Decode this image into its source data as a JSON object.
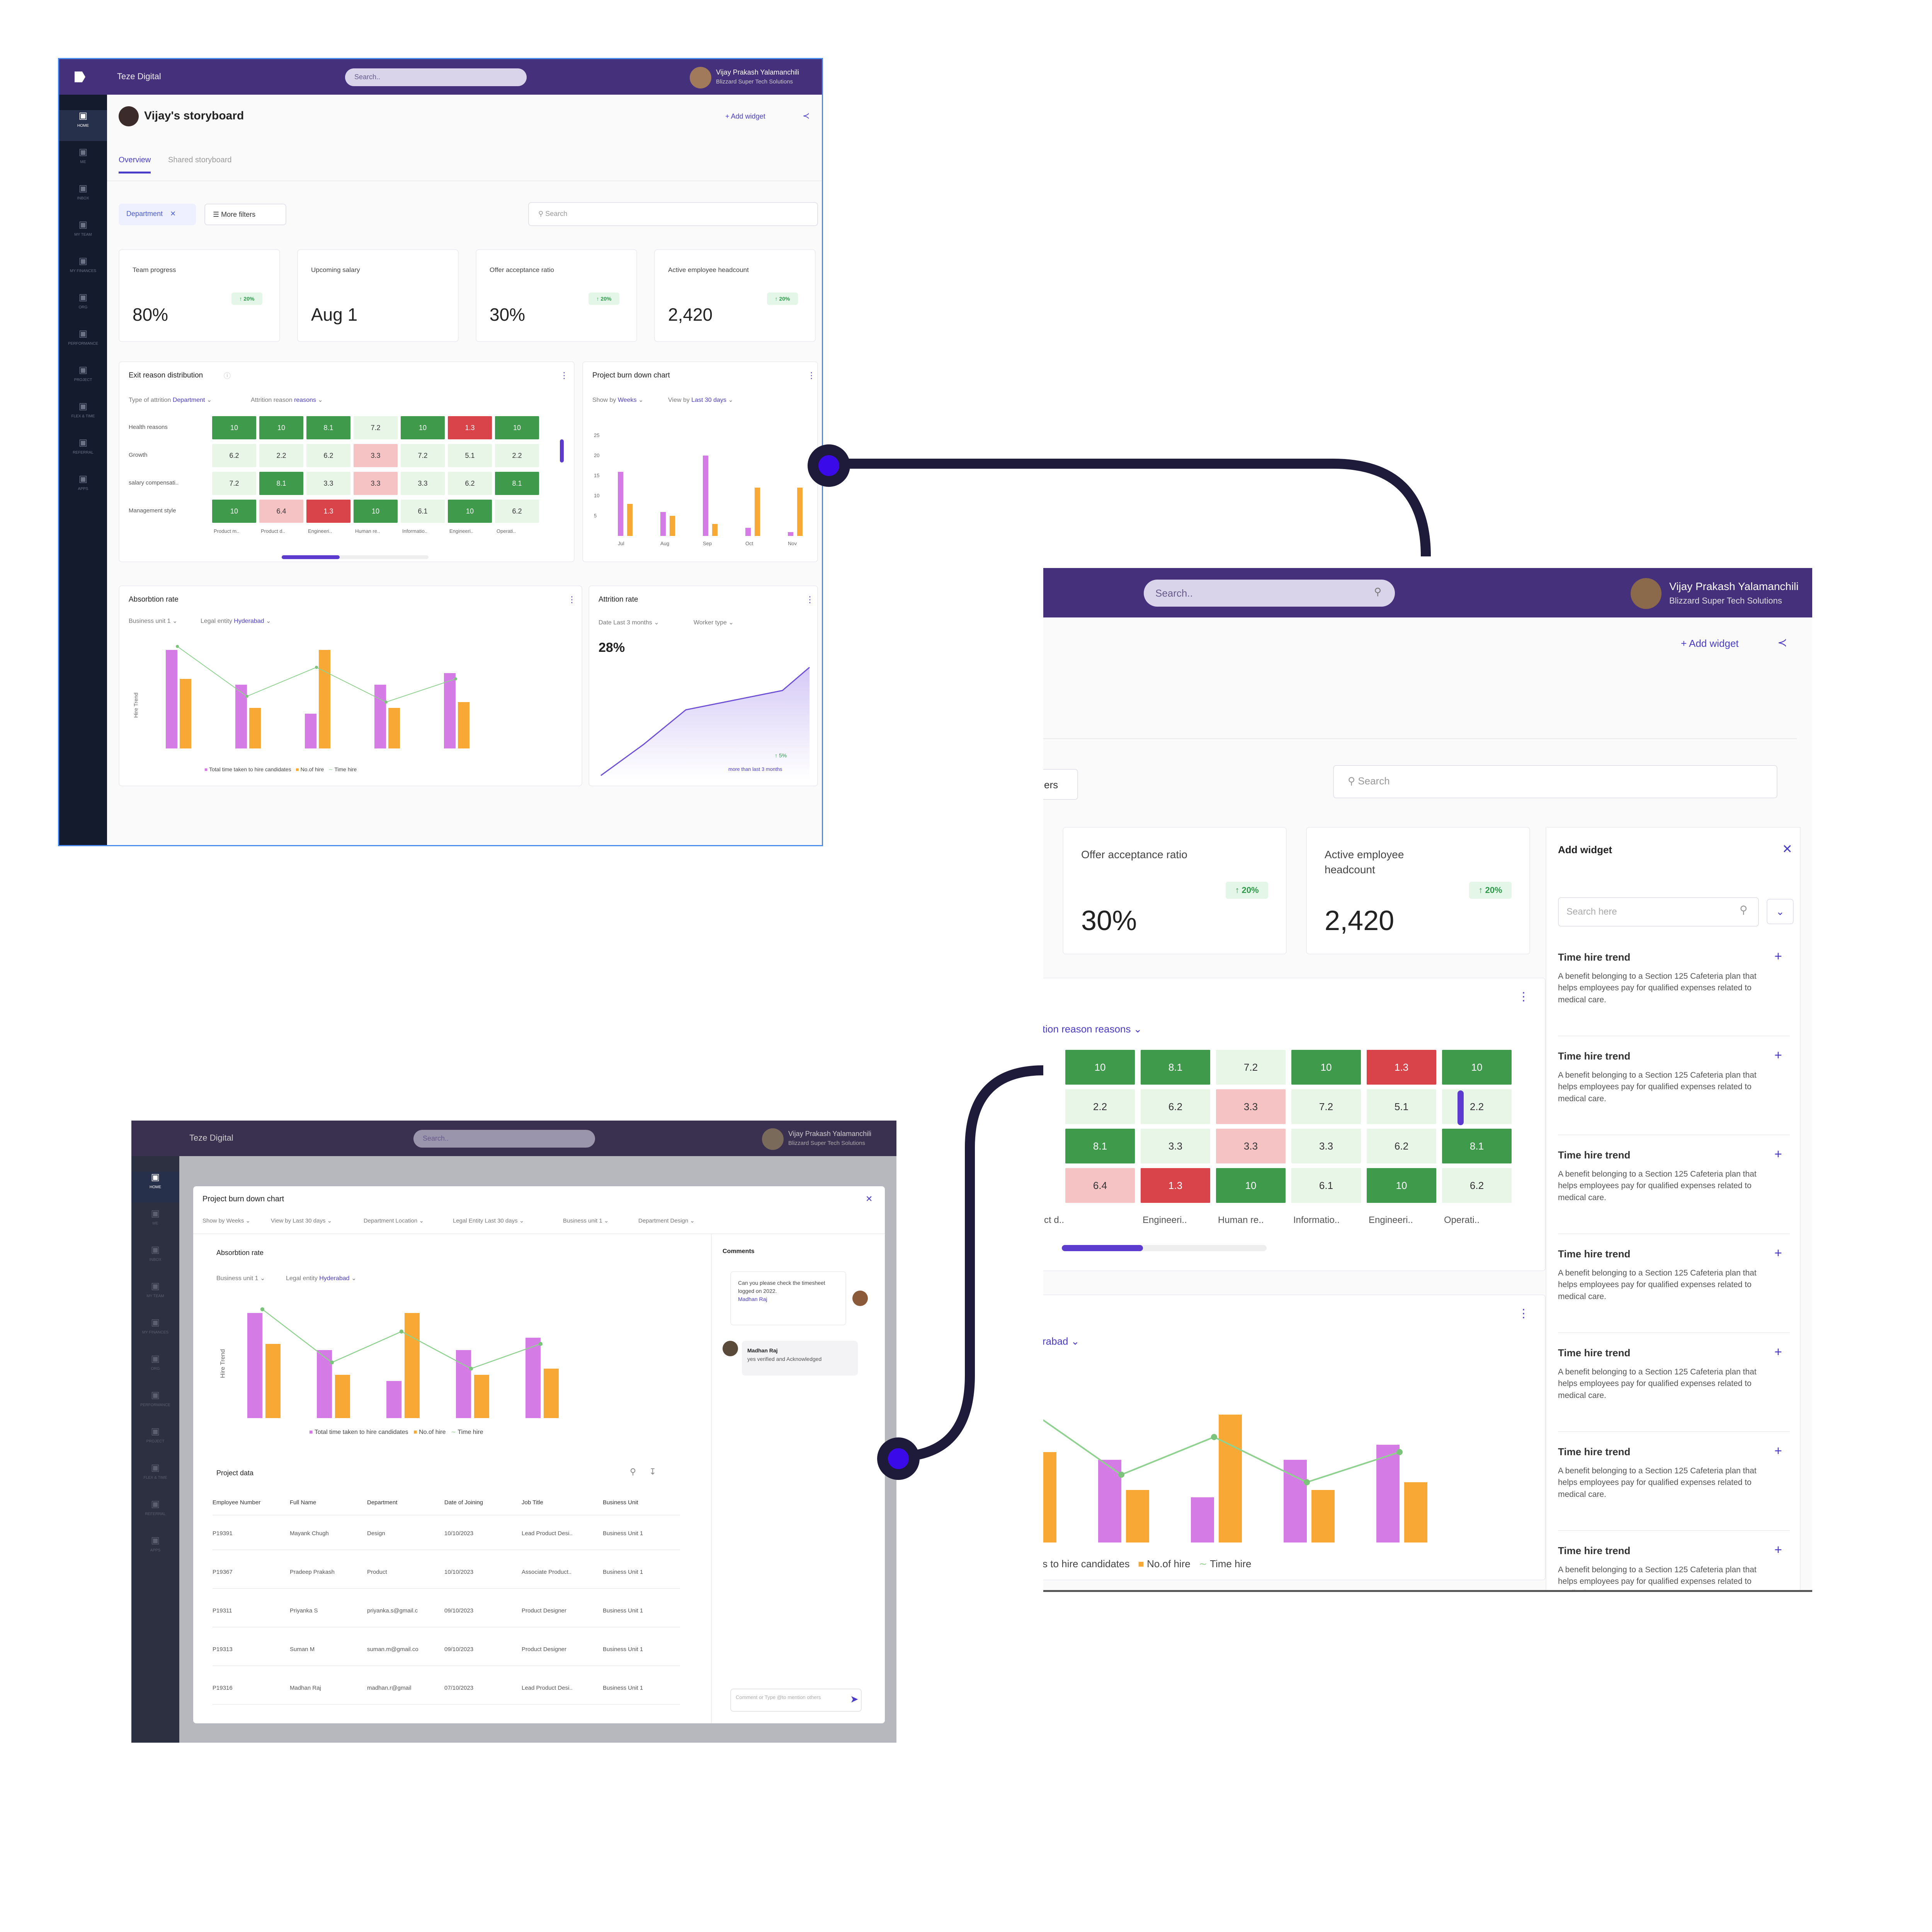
{
  "topbar": {
    "org": "Teze Digital",
    "search_placeholder": "Search..",
    "user_name": "Vijay Prakash Yalamanchili",
    "user_company": "Blizzard Super Tech Solutions"
  },
  "sidebar": [
    "HOME",
    "ME",
    "INBOX",
    "MY TEAM",
    "MY FINANCES",
    "ORG",
    "PERFORMANCE",
    "PROJECT",
    "FLEX & TIME",
    "REFERRAL",
    "APPS"
  ],
  "page": {
    "title": "Vijay's storyboard",
    "add_widget": "Add widget",
    "tabs": [
      "Overview",
      "Shared storyboard"
    ],
    "filter_chip": "Department",
    "more_filters": "More filters",
    "search_placeholder": "Search"
  },
  "kpis": [
    {
      "label": "Team progress",
      "value": "80%",
      "delta": "20%"
    },
    {
      "label": "Upcoming salary",
      "value": "Aug 1",
      "delta": ""
    },
    {
      "label": "Offer acceptance ratio",
      "value": "30%",
      "delta": "20%"
    },
    {
      "label": "Active employee headcount",
      "value": "2,420",
      "delta": "20%"
    }
  ],
  "exit_widget": {
    "title": "Exit reason distribution",
    "filter1": "Type of attrition",
    "filter1_value": "Department",
    "filter2": "Attrition reason",
    "filter2_value": "reasons",
    "rows": [
      "Health reasons",
      "Growth",
      "salary compensati..",
      "Management style"
    ],
    "cols": [
      "Product m..",
      "Product d..",
      "Engineeri..",
      "Human re..",
      "Informatio..",
      "Engineeri..",
      "Operati.."
    ],
    "cells": [
      [
        "10",
        "10",
        "8.1",
        "7.2",
        "10",
        "1.3",
        "10"
      ],
      [
        "6.2",
        "2.2",
        "6.2",
        "3.3",
        "7.2",
        "5.1",
        "2.2"
      ],
      [
        "7.2",
        "8.1",
        "3.3",
        "3.3",
        "3.3",
        "6.2",
        "8.1"
      ],
      [
        "10",
        "6.4",
        "1.3",
        "10",
        "6.1",
        "10",
        "6.2"
      ]
    ],
    "cell_colors": [
      [
        "g",
        "g",
        "g",
        "l",
        "g",
        "r",
        "g"
      ],
      [
        "l",
        "l",
        "l",
        "p",
        "l",
        "l",
        "l"
      ],
      [
        "l",
        "g",
        "l",
        "p",
        "l",
        "l",
        "g"
      ],
      [
        "g",
        "p",
        "r",
        "g",
        "l",
        "g",
        "l"
      ]
    ]
  },
  "burndown_widget": {
    "title": "Project burn down chart",
    "filter1": "Show by",
    "filter1_value": "Weeks",
    "filter2": "View by",
    "filter2_value": "Last 30 days",
    "yticks": [
      "25",
      "20",
      "15",
      "10",
      "5"
    ],
    "months": [
      "Jul",
      "Aug",
      "Sep",
      "Oct",
      "Nov"
    ],
    "purple": [
      16,
      6,
      20,
      2,
      1
    ],
    "orange": [
      8,
      5,
      3,
      12,
      12
    ]
  },
  "absorption_widget": {
    "title": "Absorbtion rate",
    "filter1": "Business unit 1",
    "filter2": "Legal entity",
    "filter2_value": "Hyderabad",
    "ylabel": "Hire Trend",
    "purple": [
      85,
      55,
      30,
      55,
      65
    ],
    "orange": [
      60,
      35,
      85,
      35,
      40
    ],
    "line": [
      88,
      45,
      70,
      40,
      60
    ],
    "legend": [
      "Total time taken to hire candidates",
      "No.of hire",
      "Time hire"
    ]
  },
  "attrition_widget": {
    "title": "Attrition rate",
    "filter1": "Date",
    "filter1_value": "Last 3 months",
    "filter2": "Worker type",
    "value": "28%",
    "delta": "5%",
    "note": "more than last 3 months"
  },
  "modal": {
    "title": "Project burn down chart",
    "filters": [
      "Show by Weeks",
      "View by Last 30 days",
      "Department Location",
      "Legal Entity Last 30 days",
      "Business unit 1",
      "Department Design"
    ],
    "chart_title": "Absorbtion rate",
    "comments_title": "Comments",
    "comment1": "Can you please check the timesheet logged on 2022.",
    "comment1_mention": "Madhan Raj",
    "comment2_author": "Madhan Raj",
    "comment2_text": "yes verified and Acknowledged",
    "comment_placeholder": "Comment or Type @to mention others",
    "table_title": "Project data",
    "table_headers": [
      "Employee Number",
      "Full Name",
      "Department",
      "Date of Joining",
      "Job Title",
      "Business Unit"
    ],
    "table_rows": [
      [
        "P19391",
        "Mayank Chugh",
        "Design",
        "10/10/2023",
        "Lead Product Desi..",
        "Business Unit 1"
      ],
      [
        "P19367",
        "Pradeep Prakash",
        "Product",
        "10/10/2023",
        "Associate Product..",
        "Business Unit 1"
      ],
      [
        "P19311",
        "Priyanka S",
        "priyanka.s@gmail.c",
        "09/10/2023",
        "Product Designer",
        "Business Unit 1"
      ],
      [
        "P19313",
        "Suman M",
        "suman.m@gmail.co",
        "09/10/2023",
        "Product Designer",
        "Business Unit 1"
      ],
      [
        "P19316",
        "Madhan Raj",
        "madhan.r@gmail",
        "07/10/2023",
        "Lead Product Desi..",
        "Business Unit 1"
      ]
    ]
  },
  "zoom": {
    "search_placeholder": "Search..",
    "add_widget": "Add widget",
    "chip_tail": "ers",
    "panel_title": "Add widget",
    "panel_search": "Search here",
    "heat_filter": "tion reason reasons",
    "hyd": "rabad",
    "legend": [
      "s to hire candidates",
      "No.of hire",
      "Time hire"
    ],
    "col_tail": [
      "ct d..",
      "Engineeri..",
      "Human re..",
      "Informatio..",
      "Engineeri..",
      "Operati.."
    ],
    "widget_item": {
      "title": "Time hire trend",
      "desc": "A benefit belonging to a Section 125 Cafeteria plan that helps employees pay for qualified expenses related to medical care."
    },
    "widget_items_count": 7
  },
  "colors": {
    "topbar": "#45307c",
    "accent": "#4a3cc9",
    "bar_purple": "#d57be6",
    "bar_orange": "#f8a935",
    "heat_green": "#3f9a4c",
    "heat_red": "#d9444a",
    "connector": "#1e1b3a",
    "dot": "#3a0ae8"
  }
}
